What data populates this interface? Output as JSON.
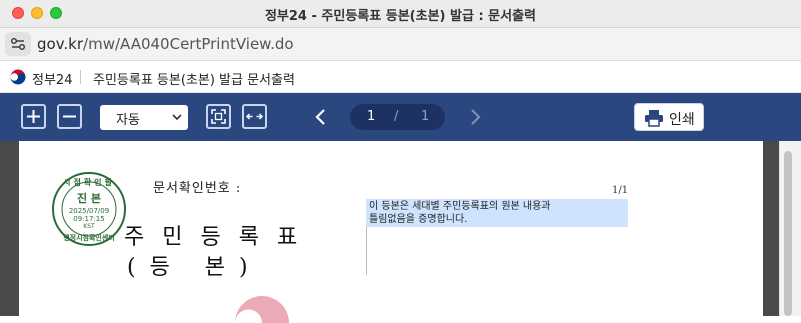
{
  "window": {
    "title": "정부24 - 주민등록표 등본(초본) 발급 : 문서출력"
  },
  "url": {
    "host": "gov.kr",
    "path": "/mw/AA040CertPrintView.do"
  },
  "header": {
    "site_name": "정부24",
    "doc_title": "주민등록표 등본(초본) 발급 문서출력"
  },
  "toolbar": {
    "zoom_value": "자동",
    "page_current": "1",
    "page_separator": "/",
    "page_total": "1",
    "print_label": "인쇄"
  },
  "document": {
    "confirm_label": "문서확인번호 :",
    "page_counter": "1/1",
    "note_line1": "이 등본은 세대별 주민등록표의 원본 내용과",
    "note_line2": "틀림없음을 증명합니다.",
    "heading": "주민등록표",
    "subheading": "(  등     본  )"
  },
  "seal": {
    "top_text": "시점확인필",
    "main_text": "진 본 ",
    "date": "2025/07/09",
    "time": "09:17:15",
    "tz": "KST",
    "bottom_text": "행정시점확인센터"
  },
  "colors": {
    "toolbar_bg": "#2b4780",
    "highlight": "#cfe3ff",
    "seal": "#2f6b39"
  }
}
